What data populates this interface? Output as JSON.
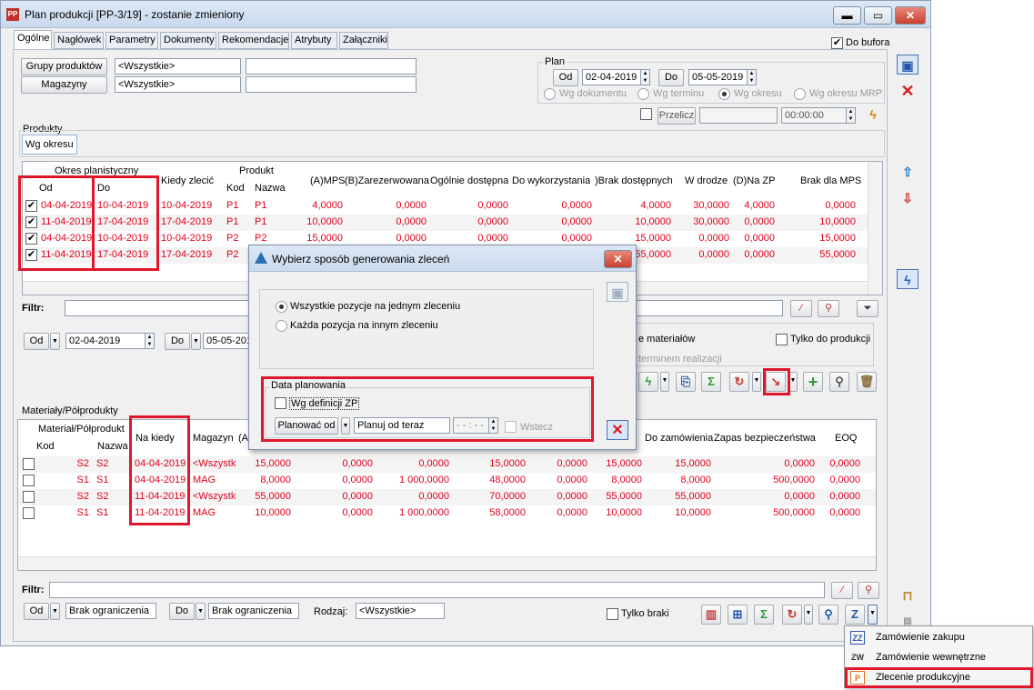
{
  "window": {
    "title": "Plan produkcji [PP-3/19] - zostanie zmieniony",
    "app_icon": "PP",
    "minimize": "▬",
    "maximize": "▭",
    "close": "✕"
  },
  "tabs": [
    "Ogólne",
    "Nagłówek",
    "Parametry",
    "Dokumenty",
    "Rekomendacje",
    "Atrybuty",
    "Załączniki"
  ],
  "do_bufora": {
    "label": "Do bufora",
    "checked": "✔"
  },
  "filters": {
    "grupy_label": "Grupy produktów",
    "grupy_value": "<Wszystkie>",
    "grupy_extra": "",
    "magazyny_label": "Magazyny",
    "magazyny_value": "<Wszystkie>",
    "magazyny_extra": ""
  },
  "plan": {
    "label": "Plan",
    "od_label": "Od",
    "od_value": "02-04-2019",
    "do_label": "Do",
    "do_value": "05-05-2019",
    "options": [
      "Wg dokumentu",
      "Wg terminu",
      "Wg okresu",
      "Wg okresu MRP"
    ],
    "przelicz": "Przelicz",
    "time": "00:00:00"
  },
  "produkty": {
    "label": "Produkty",
    "subtab": "Wg okresu",
    "group_headers": {
      "okres": "Okres planistyczny",
      "produkt": "Produkt"
    },
    "columns": [
      "Od",
      "Do",
      "Kiedy zlecić",
      "Kod",
      "Nazwa",
      "(A)MPS",
      "(B)Zarezerwowana",
      "Ogólnie dostępna",
      "Do wykorzystania",
      ")Brak dostępnych",
      "W drodze",
      "(D)Na ZP",
      "Brak dla MPS"
    ],
    "rows": [
      [
        "✔",
        "04-04-2019",
        "10-04-2019",
        "10-04-2019",
        "P1",
        "P1",
        "4,0000",
        "0,0000",
        "0,0000",
        "0,0000",
        "4,0000",
        "30,0000",
        "4,0000",
        "0,0000"
      ],
      [
        "✔",
        "11-04-2019",
        "17-04-2019",
        "17-04-2019",
        "P1",
        "P1",
        "10,0000",
        "0,0000",
        "0,0000",
        "0,0000",
        "10,0000",
        "30,0000",
        "0,0000",
        "10,0000"
      ],
      [
        "✔",
        "04-04-2019",
        "10-04-2019",
        "10-04-2019",
        "P2",
        "P2",
        "15,0000",
        "0,0000",
        "0,0000",
        "0,0000",
        "15,0000",
        "0,0000",
        "0,0000",
        "15,0000"
      ],
      [
        "✔",
        "11-04-2019",
        "17-04-2019",
        "17-04-2019",
        "P2",
        "",
        "",
        "",
        "",
        "",
        "55,0000",
        "0,0000",
        "0,0000",
        "55,0000"
      ]
    ],
    "filtr_label": "Filtr:",
    "od_label": "Od",
    "od_value": "02-04-2019",
    "do_label": "Do",
    "do_value": "05-05-201",
    "materialow_text": "e materiałów",
    "terminem_text": "terminem realizacji",
    "tylko_do_produkcji": "Tylko do produkcji"
  },
  "materialy": {
    "label": "Materiały/Półprodukty",
    "group_header": "Materiał/Półprodukt",
    "columns": [
      "Kod",
      "Nazwa",
      "Na kiedy",
      "Magazyn",
      "(A)",
      "Do zamówienia",
      "Zapas bezpieczeństwa",
      "EOQ"
    ],
    "rows": [
      [
        "S2",
        "S2",
        "04-04-2019",
        "<Wszystk",
        "15,0000",
        "0,0000",
        "0,0000",
        "15,0000",
        "0,0000",
        "15,0000",
        "15,0000",
        "0,0000",
        "0,0000"
      ],
      [
        "S1",
        "S1",
        "04-04-2019",
        "MAG",
        "8,0000",
        "0,0000",
        "1 000,0000",
        "48,0000",
        "0,0000",
        "8,0000",
        "8,0000",
        "500,0000",
        "0,0000"
      ],
      [
        "S2",
        "S2",
        "11-04-2019",
        "<Wszystk",
        "55,0000",
        "0,0000",
        "0,0000",
        "70,0000",
        "0,0000",
        "55,0000",
        "55,0000",
        "0,0000",
        "0,0000"
      ],
      [
        "S1",
        "S1",
        "11-04-2019",
        "MAG",
        "10,0000",
        "0,0000",
        "1 000,0000",
        "58,0000",
        "0,0000",
        "10,0000",
        "10,0000",
        "500,0000",
        "0,0000"
      ]
    ],
    "filtr_label": "Filtr:",
    "od_label": "Od",
    "od_value": "Brak ograniczenia",
    "do_label": "Do",
    "do_value": "Brak ograniczenia",
    "rodzaj_label": "Rodzaj:",
    "rodzaj_value": "<Wszystkie>",
    "tylko_braki": "Tylko braki"
  },
  "dialog": {
    "title": "Wybierz sposób generowania zleceń",
    "option1": "Wszystkie pozycje na jednym zleceniu",
    "option2": "Każda pozycja na innym zleceniu",
    "data_planowania": "Data planowania",
    "wg_definicji": "Wg definicji ZP",
    "planowac_od": "Planować od",
    "planuj_value": "Planuj od teraz",
    "time_value": "- - : - -",
    "wstecz": "Wstecz"
  },
  "dropdown_menu": {
    "items": [
      {
        "icon": "ZZ",
        "label": "Zamówienie zakupu"
      },
      {
        "icon": "ZW",
        "label": "Zamówienie wewnętrzne"
      },
      {
        "icon": "P",
        "label": "Zlecenie produkcyjne"
      }
    ]
  },
  "colors": {
    "highlight_red": "#e0162b",
    "row_text_red": "#e0001b"
  }
}
